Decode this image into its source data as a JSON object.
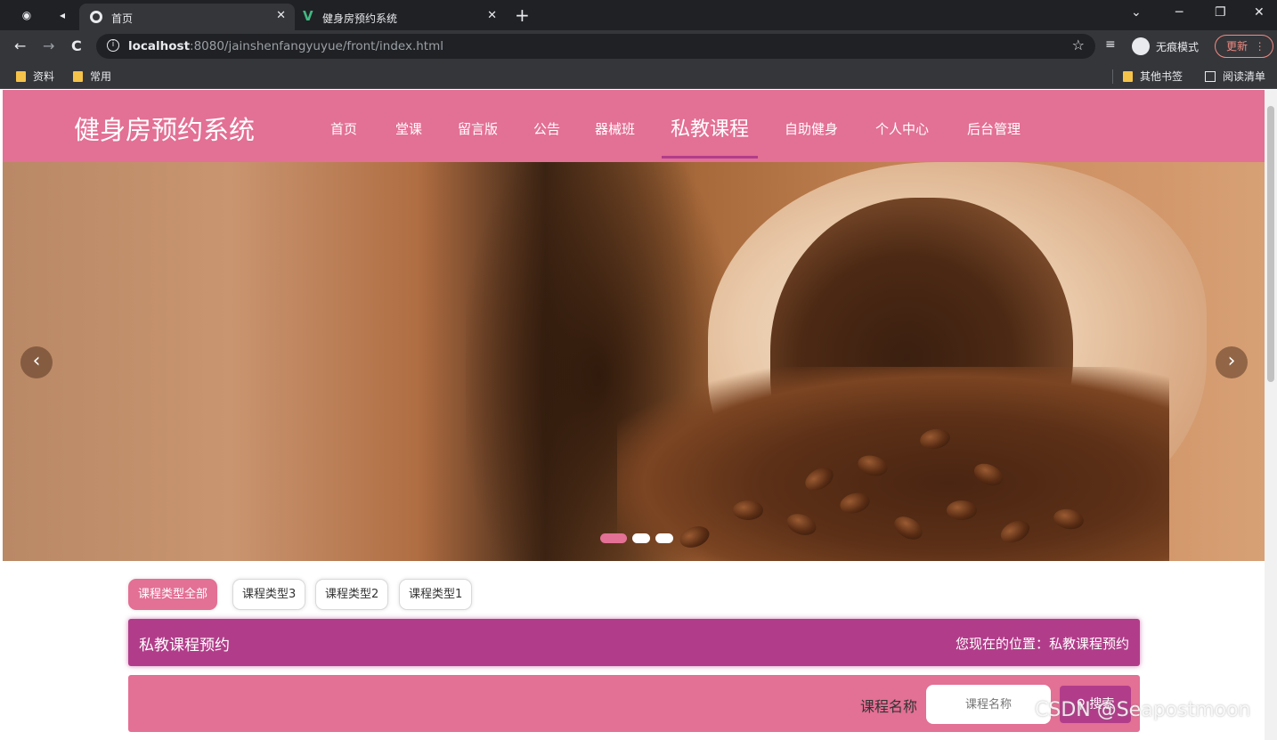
{
  "browser": {
    "tabs": [
      {
        "title": "首页",
        "active": true
      },
      {
        "title": "健身房预约系统",
        "active": false
      }
    ],
    "url_host": "localhost",
    "url_rest": ":8080/jainshenfangyuyue/front/index.html",
    "incognito_label": "无痕模式",
    "update_label": "更新",
    "bookmarks": [
      "资料",
      "常用"
    ],
    "other_bookmarks": "其他书签",
    "reading_list": "阅读清单"
  },
  "site": {
    "title": "健身房预约系统",
    "nav": [
      "首页",
      "堂课",
      "留言版",
      "公告",
      "器械班",
      "私教课程",
      "自助健身",
      "个人中心",
      "后台管理"
    ],
    "active_nav": "私教课程"
  },
  "carousel": {
    "prev": "‹",
    "next": "›",
    "slides_count": 3,
    "active_slide": 1
  },
  "filters": [
    "课程类型全部",
    "课程类型3",
    "课程类型2",
    "课程类型1"
  ],
  "crumb": {
    "title": "私教课程预约",
    "location": "您现在的位置：私教课程预约"
  },
  "search": {
    "label": "课程名称",
    "placeholder": "课程名称",
    "button": "搜索"
  },
  "watermark": "CSDN @Seapostmoon",
  "colors": {
    "primary": "#e37095",
    "secondary": "#b13d8a"
  }
}
